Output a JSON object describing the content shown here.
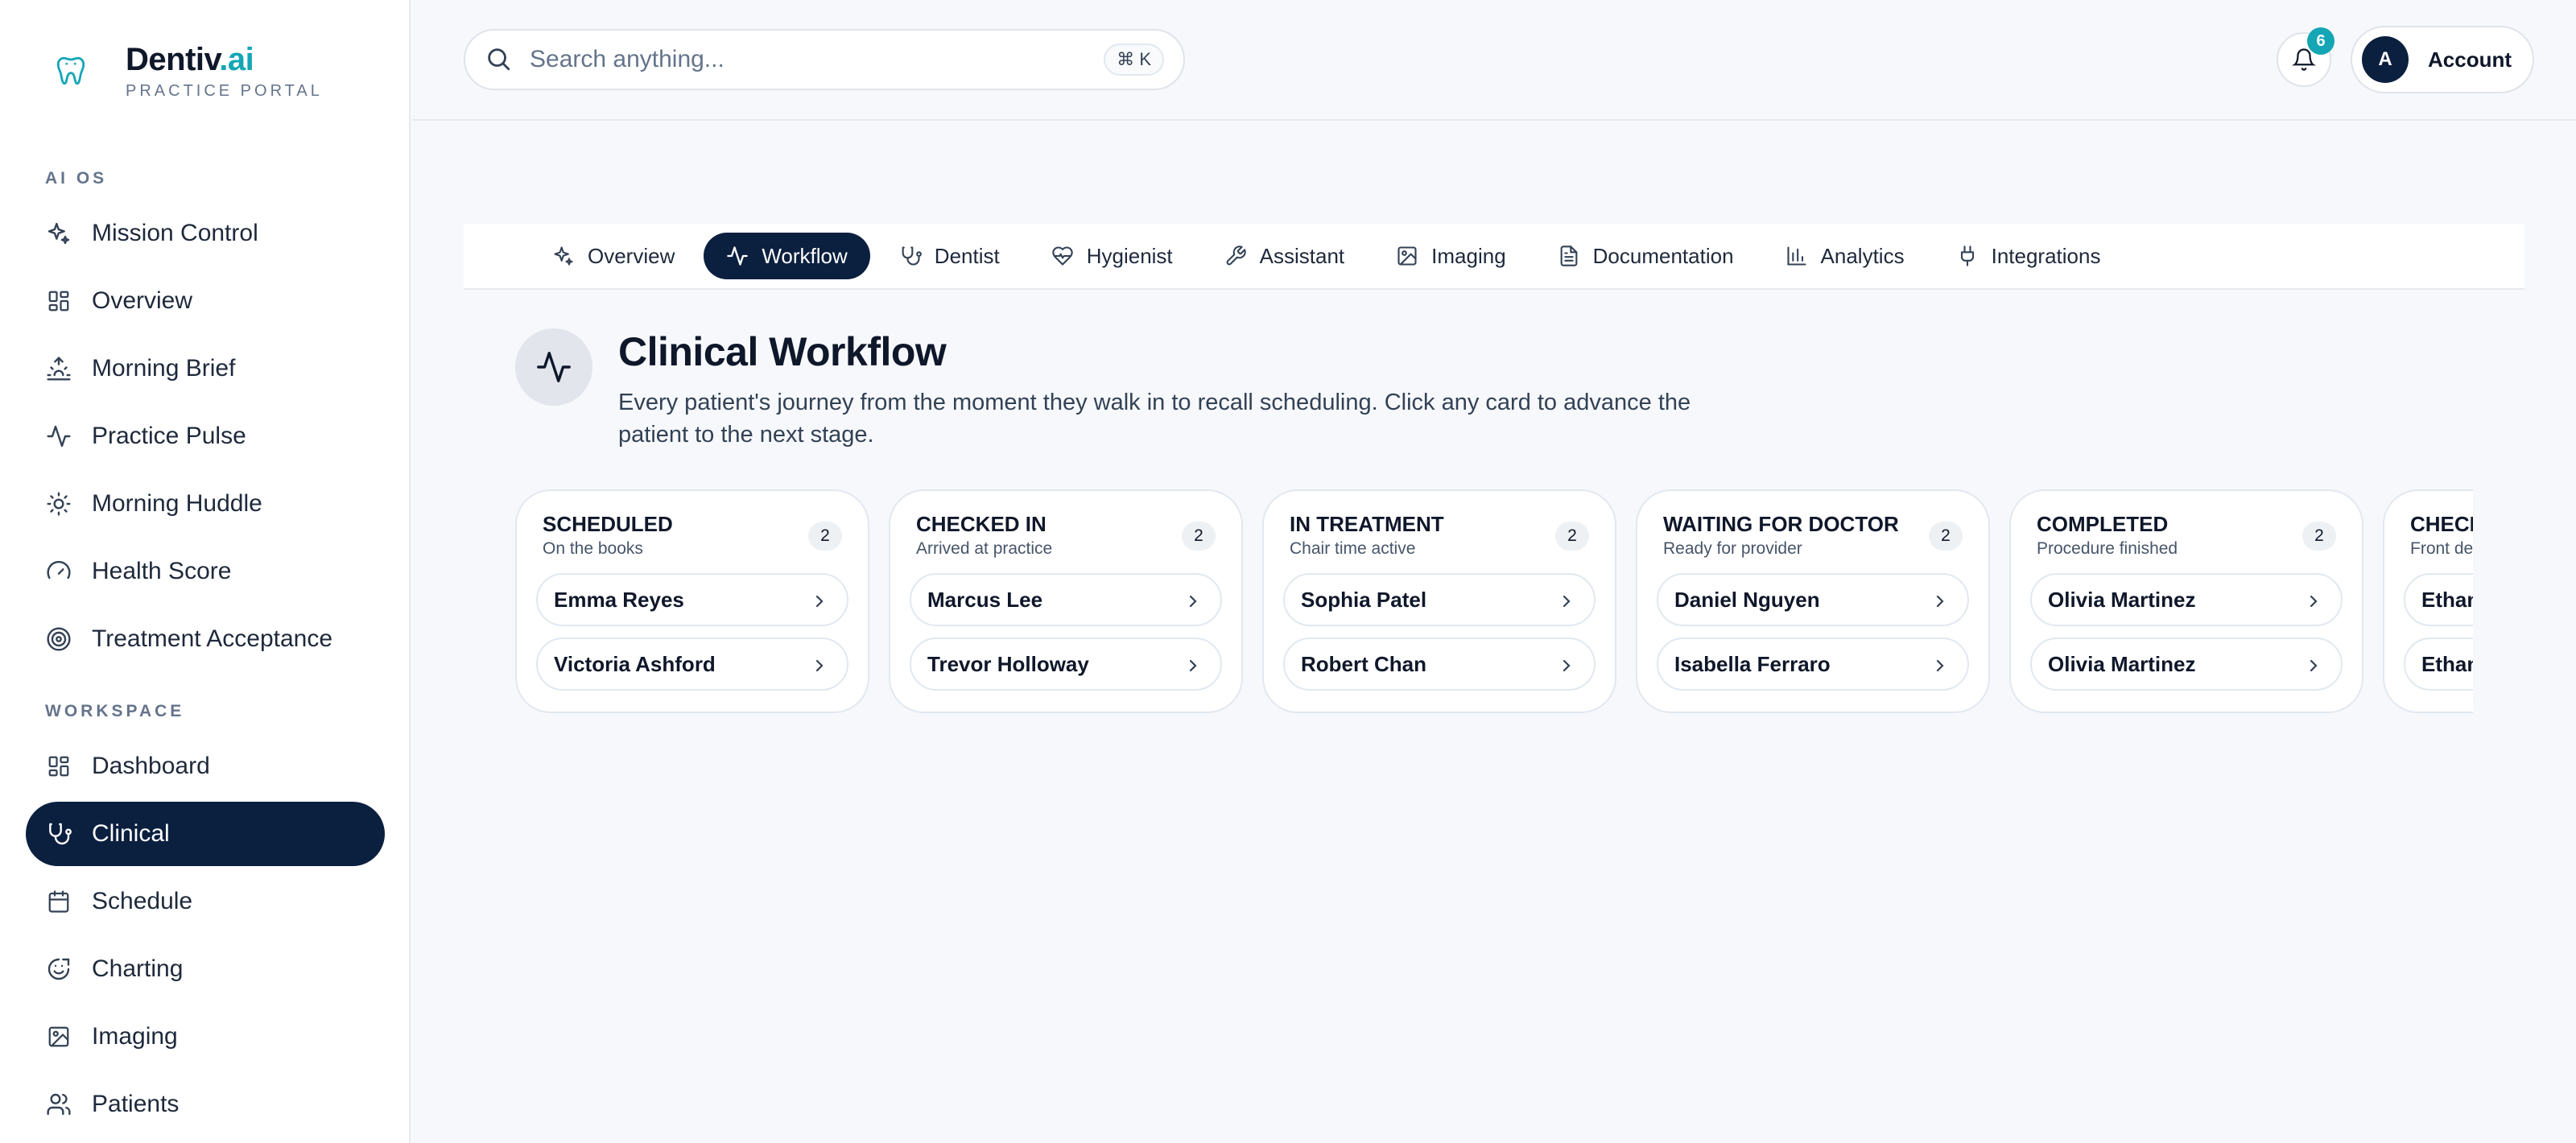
{
  "brand": {
    "name": "Dentiv",
    "suffix": ".ai",
    "subtitle": "PRACTICE PORTAL"
  },
  "sidebar": {
    "sections": [
      {
        "label": "AI OS"
      },
      {
        "label": "WORKSPACE"
      }
    ],
    "items": [
      {
        "label": "Mission Control",
        "icon": "sparkles-icon"
      },
      {
        "label": "Overview",
        "icon": "grid-icon"
      },
      {
        "label": "Morning Brief",
        "icon": "sunrise-icon"
      },
      {
        "label": "Practice Pulse",
        "icon": "pulse-icon"
      },
      {
        "label": "Morning Huddle",
        "icon": "sun-icon"
      },
      {
        "label": "Health Score",
        "icon": "gauge-icon"
      },
      {
        "label": "Treatment Acceptance",
        "icon": "target-icon"
      },
      {
        "label": "Dashboard",
        "icon": "grid-icon"
      },
      {
        "label": "Clinical",
        "icon": "stethoscope-icon",
        "active": true
      },
      {
        "label": "Schedule",
        "icon": "calendar-icon"
      },
      {
        "label": "Charting",
        "icon": "chart-smile-icon"
      },
      {
        "label": "Imaging",
        "icon": "image-icon"
      },
      {
        "label": "Patients",
        "icon": "users-icon"
      }
    ]
  },
  "header": {
    "search_placeholder": "Search anything...",
    "shortcut": "⌘ K",
    "notification_count": "6",
    "account_initial": "A",
    "account_label": "Account"
  },
  "tabs": [
    {
      "label": "Overview",
      "icon": "sparkles-icon"
    },
    {
      "label": "Workflow",
      "icon": "pulse-icon",
      "active": true
    },
    {
      "label": "Dentist",
      "icon": "stethoscope-icon"
    },
    {
      "label": "Hygienist",
      "icon": "heart-pulse-icon"
    },
    {
      "label": "Assistant",
      "icon": "wrench-icon"
    },
    {
      "label": "Imaging",
      "icon": "image-icon"
    },
    {
      "label": "Documentation",
      "icon": "document-icon"
    },
    {
      "label": "Analytics",
      "icon": "bar-chart-icon"
    },
    {
      "label": "Integrations",
      "icon": "plug-icon"
    }
  ],
  "page": {
    "title": "Clinical Workflow",
    "subtitle": "Every patient's journey from the moment they walk in to recall scheduling. Click any card to advance the patient to the next stage."
  },
  "board": {
    "columns": [
      {
        "title": "SCHEDULED",
        "subtitle": "On the books",
        "count": "2",
        "patients": [
          "Emma Reyes",
          "Victoria Ashford"
        ]
      },
      {
        "title": "CHECKED IN",
        "subtitle": "Arrived at practice",
        "count": "2",
        "patients": [
          "Marcus Lee",
          "Trevor Holloway"
        ]
      },
      {
        "title": "IN TREATMENT",
        "subtitle": "Chair time active",
        "count": "2",
        "patients": [
          "Sophia Patel",
          "Robert Chan"
        ]
      },
      {
        "title": "WAITING FOR DOCTOR",
        "subtitle": "Ready for provider",
        "count": "2",
        "patients": [
          "Daniel Nguyen",
          "Isabella Ferraro"
        ]
      },
      {
        "title": "COMPLETED",
        "subtitle": "Procedure finished",
        "count": "2",
        "patients": [
          "Olivia Martinez",
          "Olivia Martinez"
        ]
      },
      {
        "title": "CHECK",
        "subtitle": "Front de",
        "count": "",
        "patients": [
          "Ethan",
          "Ethan"
        ]
      }
    ]
  },
  "colors": {
    "navy": "#0b1f3f",
    "accent": "#14a6b5",
    "background": "#f6f8fb"
  }
}
